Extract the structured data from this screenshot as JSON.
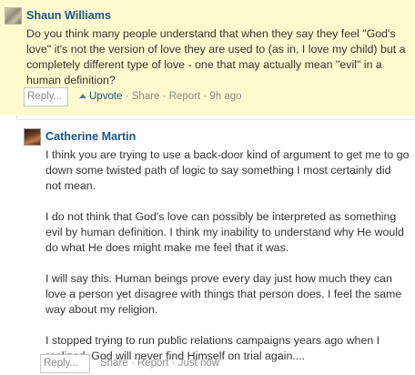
{
  "comment_parent": {
    "author": "Shaun Williams",
    "text": "Do you think many people understand that when they say they feel \"God's love\" it's not the version of love they are used to (as in, I love my child) but a completely different type of love - one that may actually mean \"evil\" in a human definition?",
    "reply_placeholder": "Reply...",
    "upvote_label": "Upvote",
    "separator": "·",
    "share_label": "Share",
    "report_label": "Report",
    "timestamp": "9h ago"
  },
  "comment_reply": {
    "author": "Catherine Martin",
    "paragraphs": [
      "I think you are trying to use a back-door kind of argument to get me to go down some twisted path of logic to say something I most certainly did not mean.",
      "I do not think that God's love can possibly be interpreted as something evil by human definition. I think my inability to understand why He would do what He does might make me feel that it was.",
      "I will say this. Human beings prove every day just how much they can love a person yet disagree with things that person does. I feel the same way about my religion.",
      "I stopped trying to run public relations campaigns years ago when I realized, God will never find Himself on trial again...."
    ],
    "reply_placeholder": "Reply...",
    "separator": "·",
    "share_label": "Share",
    "report_label": "Report",
    "timestamp": "Just now"
  },
  "colors": {
    "highlight_background": "#fdfbce",
    "author_link": "#19558d",
    "meta_text": "#8a8a8a"
  }
}
